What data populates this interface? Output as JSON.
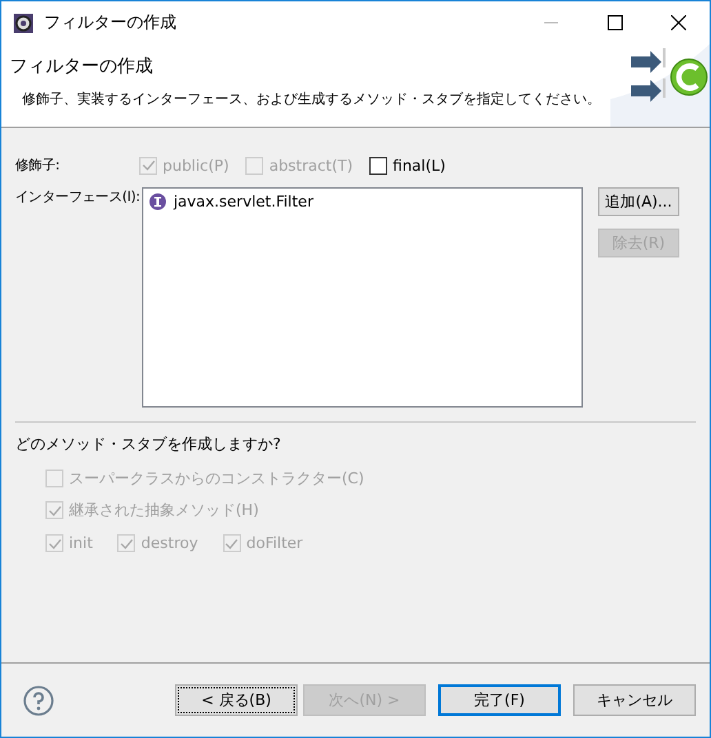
{
  "window": {
    "title": "フィルターの作成"
  },
  "banner": {
    "title": "フィルターの作成",
    "description": "修飾子、実装するインターフェース、および生成するメソッド・スタブを指定してください。"
  },
  "modifiers": {
    "label": "修飾子:",
    "options": [
      {
        "label": "public(P)",
        "checked": true,
        "disabled": true
      },
      {
        "label": "abstract(T)",
        "checked": false,
        "disabled": true
      },
      {
        "label": "final(L)",
        "checked": false,
        "disabled": false
      }
    ]
  },
  "interfaces": {
    "label": "インターフェース(I):",
    "items": [
      {
        "name": "javax.servlet.Filter"
      }
    ],
    "buttons": [
      {
        "label": "追加(A)...",
        "disabled": false
      },
      {
        "label": "除去(R)",
        "disabled": true
      }
    ]
  },
  "stubs": {
    "question": "どのメソッド・スタブを作成しますか?",
    "options": [
      {
        "label": "スーパークラスからのコンストラクター(C)",
        "checked": false,
        "disabled": true
      },
      {
        "label": "継承された抽象メソッド(H)",
        "checked": true,
        "disabled": true
      }
    ],
    "methods": [
      {
        "label": "init",
        "checked": true,
        "disabled": true
      },
      {
        "label": "destroy",
        "checked": true,
        "disabled": true
      },
      {
        "label": "doFilter",
        "checked": true,
        "disabled": true
      }
    ]
  },
  "footer": {
    "buttons": [
      {
        "label": "< 戻る(B)",
        "disabled": false,
        "focused": true,
        "default": false
      },
      {
        "label": "次へ(N) >",
        "disabled": true,
        "focused": false,
        "default": false
      },
      {
        "label": "完了(F)",
        "disabled": false,
        "focused": false,
        "default": true
      },
      {
        "label": "キャンセル",
        "disabled": false,
        "focused": false,
        "default": false
      }
    ]
  }
}
